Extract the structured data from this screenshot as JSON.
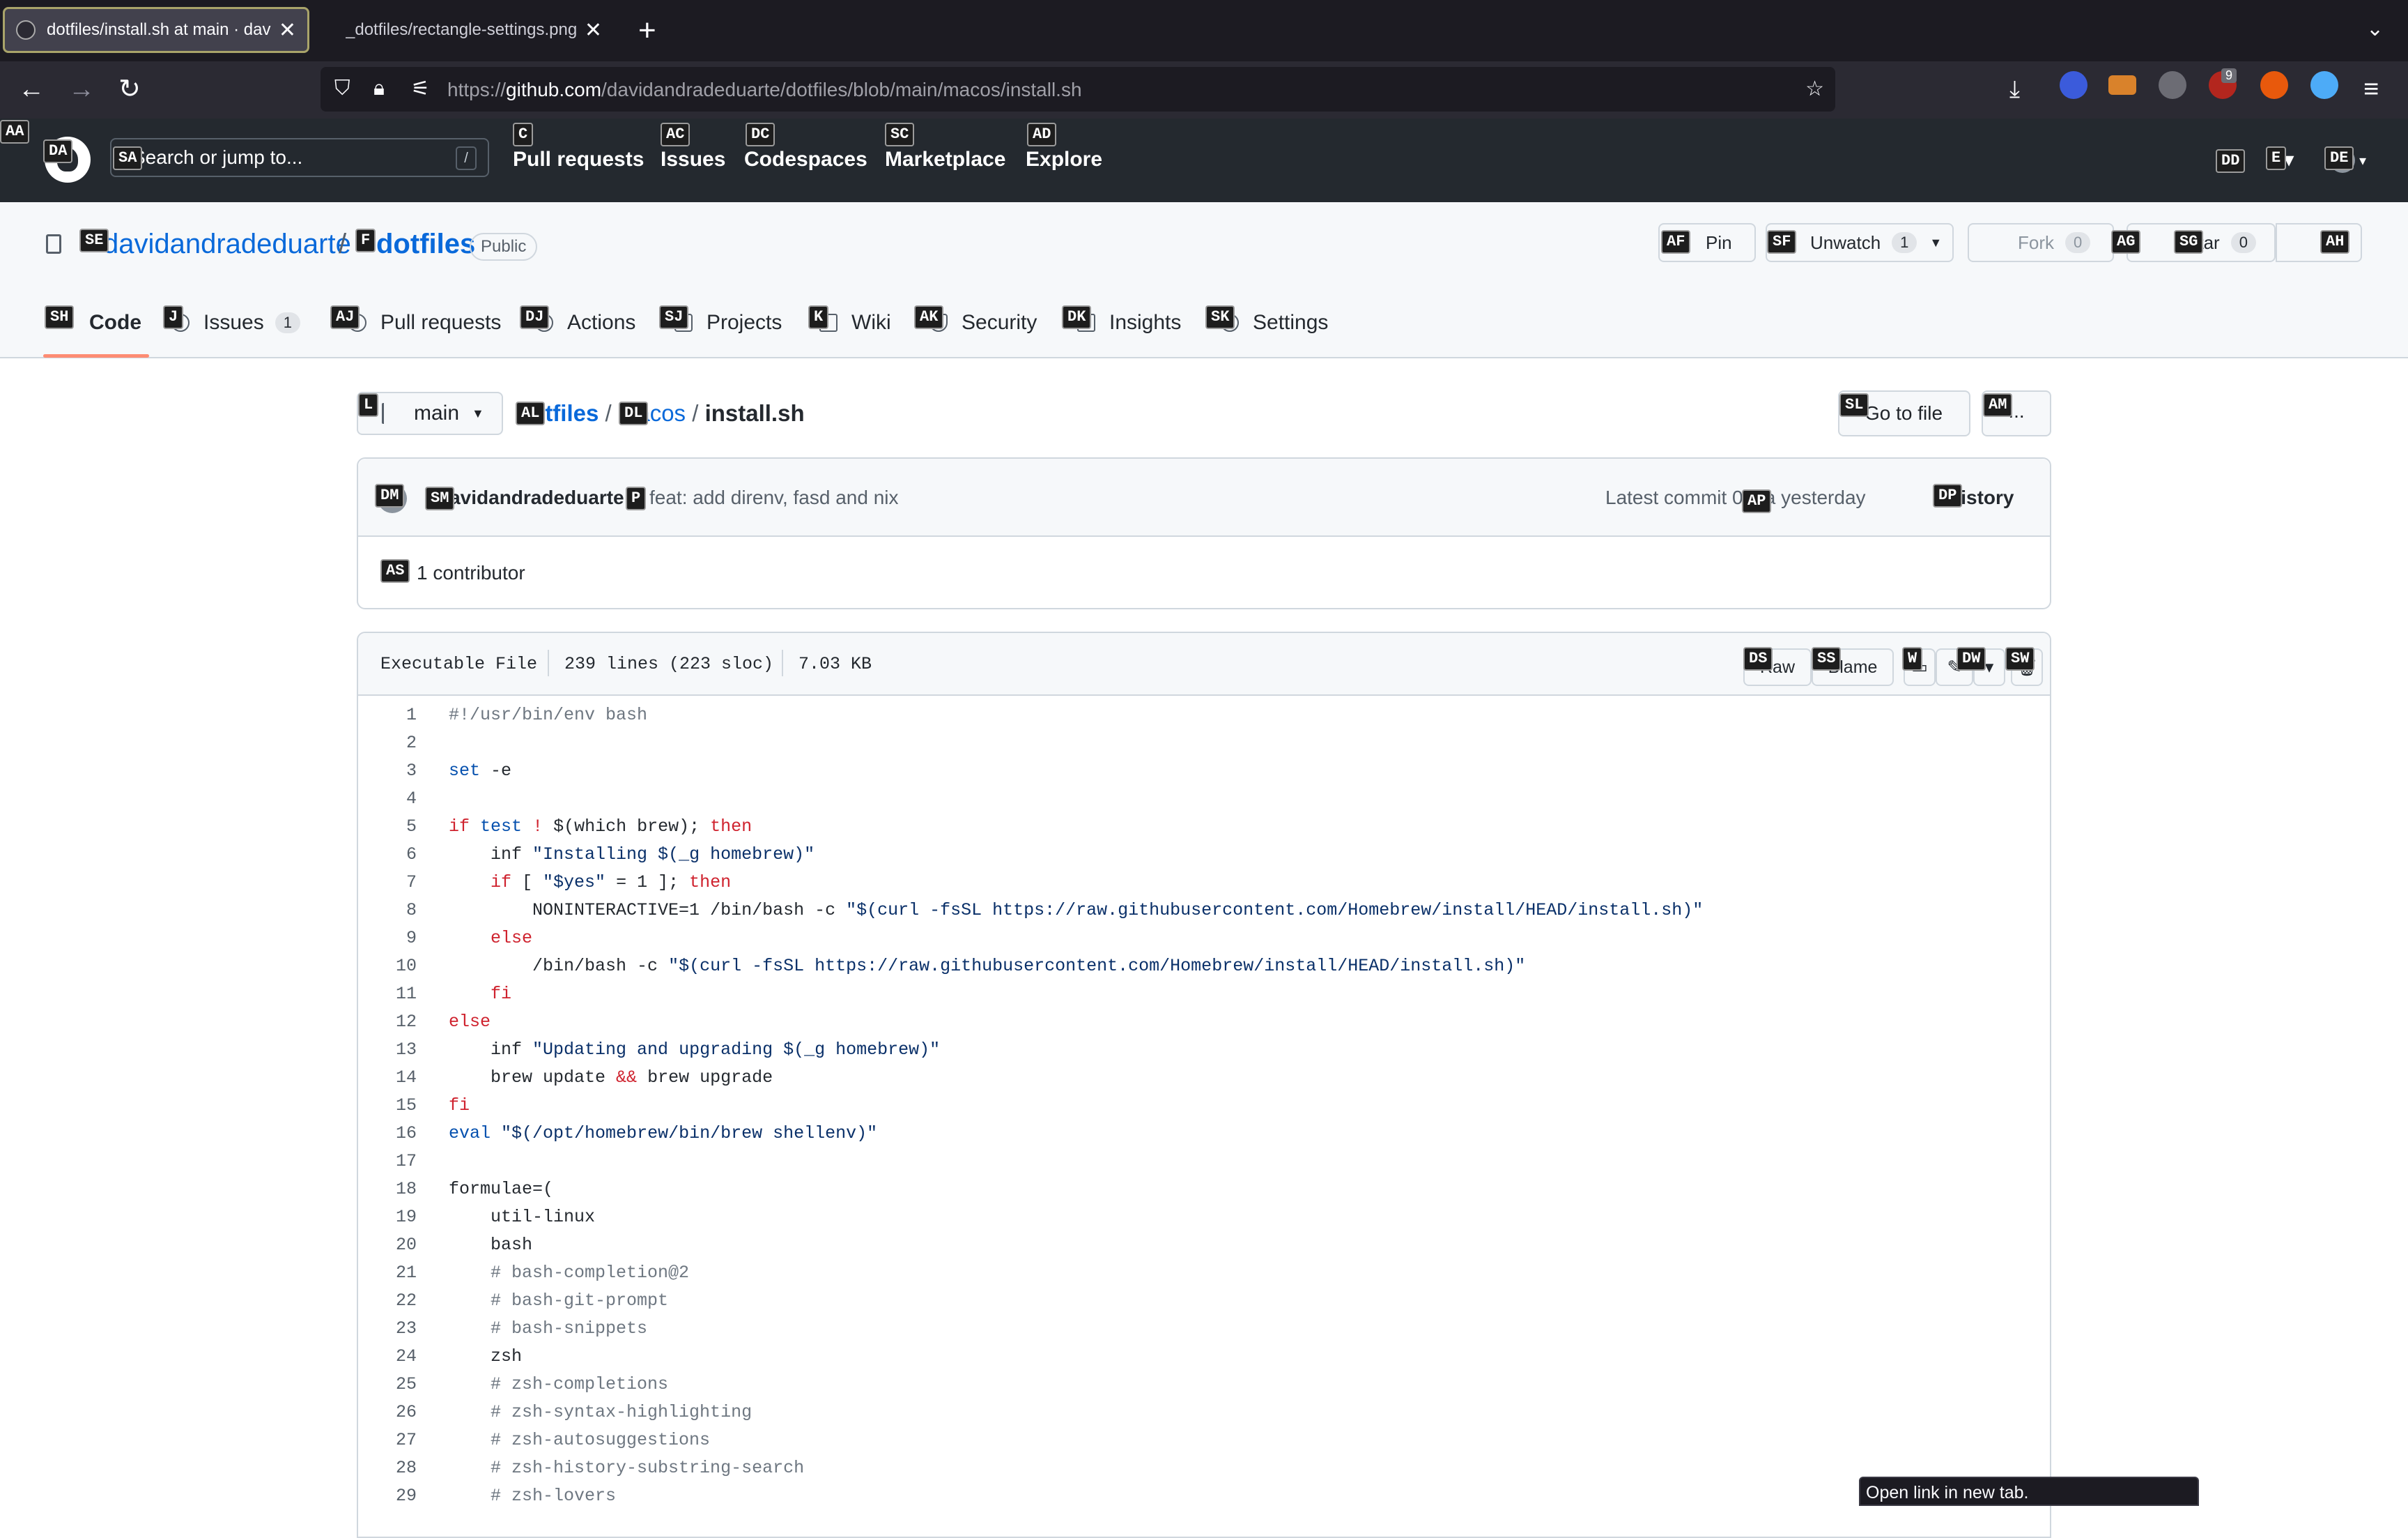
{
  "browser": {
    "tabs": [
      {
        "title": "dotfiles/install.sh at main · davidandradeduarte/dotfiles"
      },
      {
        "title": "_dotfiles/rectangle-settings.png"
      }
    ],
    "url_prefix": "https://",
    "url_host": "github.com",
    "url_path": "/davidandradeduarte/dotfiles/blob/main/macos/install.sh",
    "badge_count": "9"
  },
  "github": {
    "search_placeholder": "Search or jump to...",
    "search_key": "/",
    "nav": [
      "Pull requests",
      "Issues",
      "Codespaces",
      "Marketplace",
      "Explore"
    ]
  },
  "repo": {
    "owner": "davidandradeduarte",
    "name": "dotfiles",
    "visibility": "Public",
    "pin_label": "Pin",
    "unwatch_label": "Unwatch",
    "unwatch_count": "1",
    "fork_label": "Fork",
    "fork_count": "0",
    "star_label": "Star",
    "star_count": "0",
    "tabs": [
      {
        "label": "Code",
        "count": ""
      },
      {
        "label": "Issues",
        "count": "1"
      },
      {
        "label": "Pull requests",
        "count": ""
      },
      {
        "label": "Actions",
        "count": ""
      },
      {
        "label": "Projects",
        "count": ""
      },
      {
        "label": "Wiki",
        "count": ""
      },
      {
        "label": "Security",
        "count": ""
      },
      {
        "label": "Insights",
        "count": ""
      },
      {
        "label": "Settings",
        "count": ""
      }
    ]
  },
  "file": {
    "branch": "main",
    "crumbs": [
      "dotfiles",
      "macos",
      "install.sh"
    ],
    "goto_label": "Go to file",
    "more_label": "...",
    "commit_author": "davidandradeduarte",
    "commit_message": "feat: add direnv, fasd and nix",
    "latest_commit": "Latest commit 0a3a yesterday",
    "history_label": "History",
    "contributors": "1 contributor",
    "file_type": "Executable File",
    "lines_info": "239 lines (223 sloc)",
    "size": "7.03 KB",
    "raw_label": "Raw",
    "blame_label": "Blame"
  },
  "code": [
    "#!/usr/bin/env bash",
    "",
    "set -e",
    "",
    "if test ! $(which brew); then",
    "    inf \"Installing $(_g homebrew)\"",
    "    if [ \"$yes\" = 1 ]; then",
    "        NONINTERACTIVE=1 /bin/bash -c \"$(curl -fsSL https://raw.githubusercontent.com/Homebrew/install/HEAD/install.sh)\"",
    "    else",
    "        /bin/bash -c \"$(curl -fsSL https://raw.githubusercontent.com/Homebrew/install/HEAD/install.sh)\"",
    "    fi",
    "else",
    "    inf \"Updating and upgrading $(_g homebrew)\"",
    "    brew update && brew upgrade",
    "fi",
    "eval \"$(/opt/homebrew/bin/brew shellenv)\"",
    "",
    "formulae=(",
    "    util-linux",
    "    bash",
    "    # bash-completion@2",
    "    # bash-git-prompt",
    "    # bash-snippets",
    "    zsh",
    "    # zsh-completions",
    "    # zsh-syntax-highlighting",
    "    # zsh-autosuggestions",
    "    # zsh-history-substring-search",
    "    # zsh-lovers"
  ],
  "hints": [
    "AA",
    "SE",
    "F",
    "AF",
    "SF",
    "AG",
    "SG",
    "AH",
    "SH",
    "J",
    "AJ",
    "DJ",
    "SJ",
    "K",
    "AK",
    "DK",
    "SK",
    "L",
    "AL",
    "DL",
    "SL",
    "AM",
    "DM",
    "SM",
    "P",
    "AP",
    "DP",
    "AS",
    "DS",
    "SS",
    "W",
    "DW",
    "SW",
    "DA",
    "SA",
    "C",
    "AC",
    "DC",
    "SC",
    "AD",
    "DD",
    "E",
    "DE"
  ],
  "status_text": "Open link in new tab."
}
